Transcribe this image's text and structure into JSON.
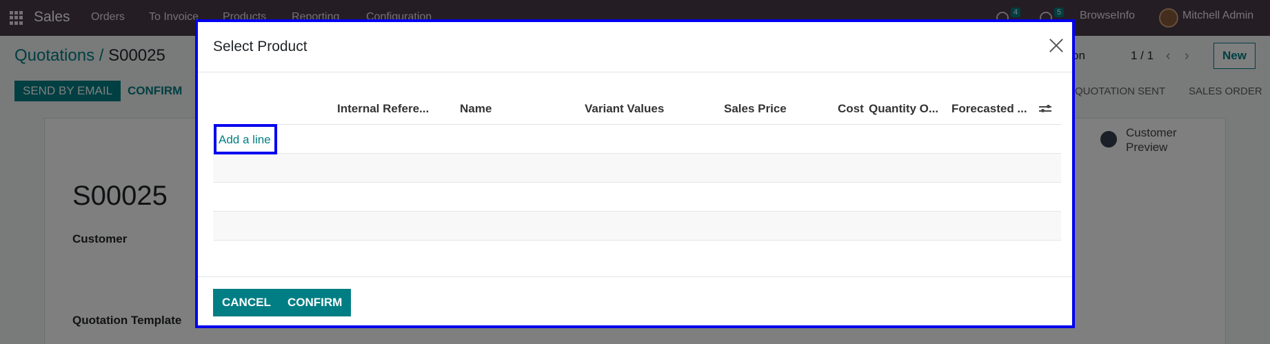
{
  "navbar": {
    "app_name": "Sales",
    "menu": [
      "Orders",
      "To Invoice",
      "Products",
      "Reporting",
      "Configuration"
    ],
    "messages_count": "4",
    "activities_count": "5",
    "company": "BrowseInfo",
    "user": "Mitchell Admin"
  },
  "control_panel": {
    "breadcrumb_parent": "Quotations",
    "breadcrumb_separator": "/",
    "breadcrumb_current": "S00025",
    "action_label": "ction",
    "pager": "1 / 1",
    "new_label": "New",
    "send_email_label": "SEND BY EMAIL",
    "confirm_label": "CONFIRM",
    "status_steps": [
      "QUOTATION SENT",
      "SALES ORDER"
    ]
  },
  "form": {
    "order_name": "S00025",
    "customer_label": "Customer",
    "quotation_template_label": "Quotation Template",
    "customer_preview_line1": "Customer",
    "customer_preview_line2": "Preview"
  },
  "dialog": {
    "title": "Select Product",
    "columns": [
      "Internal Refere...",
      "Name",
      "Variant Values",
      "Sales Price",
      "Cost",
      "Quantity O...",
      "Forecasted ..."
    ],
    "add_line_label": "Add a line",
    "cancel_label": "CANCEL",
    "confirm_label": "CONFIRM"
  },
  "colors": {
    "navbar": "#4b3a49",
    "primary": "#017e84",
    "highlight_border": "#0000ee"
  }
}
